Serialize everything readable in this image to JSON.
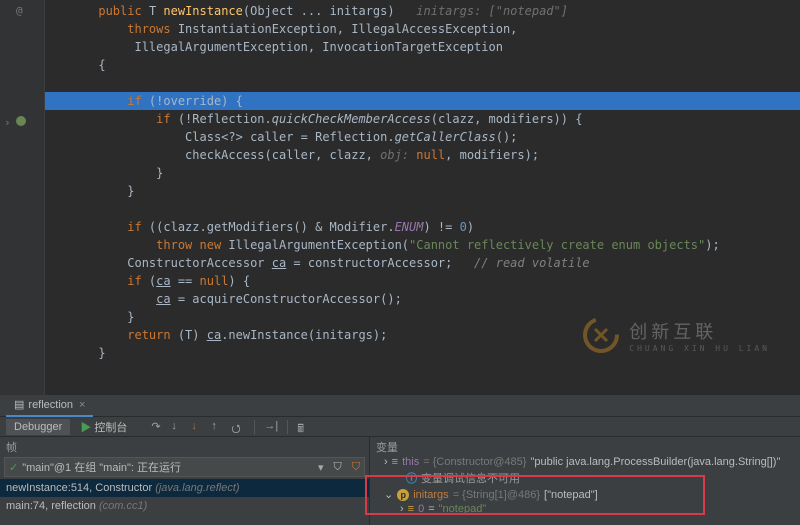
{
  "code": {
    "l1": "public T newInstance(Object ... initargs)",
    "l1_hint": "initargs: [\"notepad\"]",
    "l2a": "throws",
    "l2b": " InstantiationException, IllegalAccessException,",
    "l3": "           IllegalArgumentException, InvocationTargetException",
    "l4": "{",
    "l5a": "if",
    "l5b": " (!override) {",
    "l6a": "if",
    "l6b": " (!Reflection.",
    "l6c": "quickCheckMemberAccess",
    "l6d": "(clazz, modifiers)) {",
    "l7a": "Class<?> caller = Reflection.",
    "l7b": "getCallerClass",
    "l7c": "();",
    "l8a": "checkAccess(caller, clazz, ",
    "l8b": "obj: ",
    "l8c": "null",
    "l8d": ", modifiers);",
    "l9": "}",
    "l10": "}",
    "l11a": "if",
    "l11b": " ((clazz.getModifiers() & Modifier.",
    "l11c": "ENUM",
    "l11d": ") != ",
    "l11e": "0",
    "l11f": ")",
    "l12a": "throw new",
    "l12b": " IllegalArgumentException(",
    "l12c": "\"Cannot reflectively create enum objects\"",
    "l12d": ");",
    "l13a": "ConstructorAccessor ",
    "l13b": "ca",
    "l13c": " = constructorAccessor;   ",
    "l13d": "// read volatile",
    "l14a": "if",
    "l14b": " (",
    "l14c": "ca",
    "l14d": " == ",
    "l14e": "null",
    "l14f": ") {",
    "l15a": "ca",
    "l15b": " = acquireConstructorAccessor();",
    "l16": "}",
    "l17a": "return",
    "l17b": " (T) ",
    "l17c": "ca",
    "l17d": ".newInstance(initargs);",
    "l18": "}"
  },
  "watermark": {
    "cn": "创新互联",
    "en": "CHUANG XIN HU LIAN"
  },
  "debugger": {
    "tool_tab": "reflection",
    "tabs": {
      "debugger": "Debugger",
      "console": "控制台"
    },
    "frames": {
      "header": "帧",
      "thread": "\"main\"@1 在组 \"main\": 正在运行",
      "f0": "newInstance:514, Constructor",
      "f0_pkg": "(java.lang.reflect)",
      "f1": "main:74, reflection",
      "f1_pkg": "(com.cc1)"
    },
    "vars": {
      "header": "变量",
      "this_label": "this",
      "this_val": "{Constructor@485}",
      "this_str": "\"public java.lang.ProcessBuilder(java.lang.String[])\"",
      "info": "变量调试信息不可用",
      "initargs_label": "initargs",
      "initargs_val": "{String[1]@486}",
      "initargs_str": "[\"notepad\"]",
      "idx0_label": "0",
      "idx0_val": "\"notepad\""
    }
  }
}
